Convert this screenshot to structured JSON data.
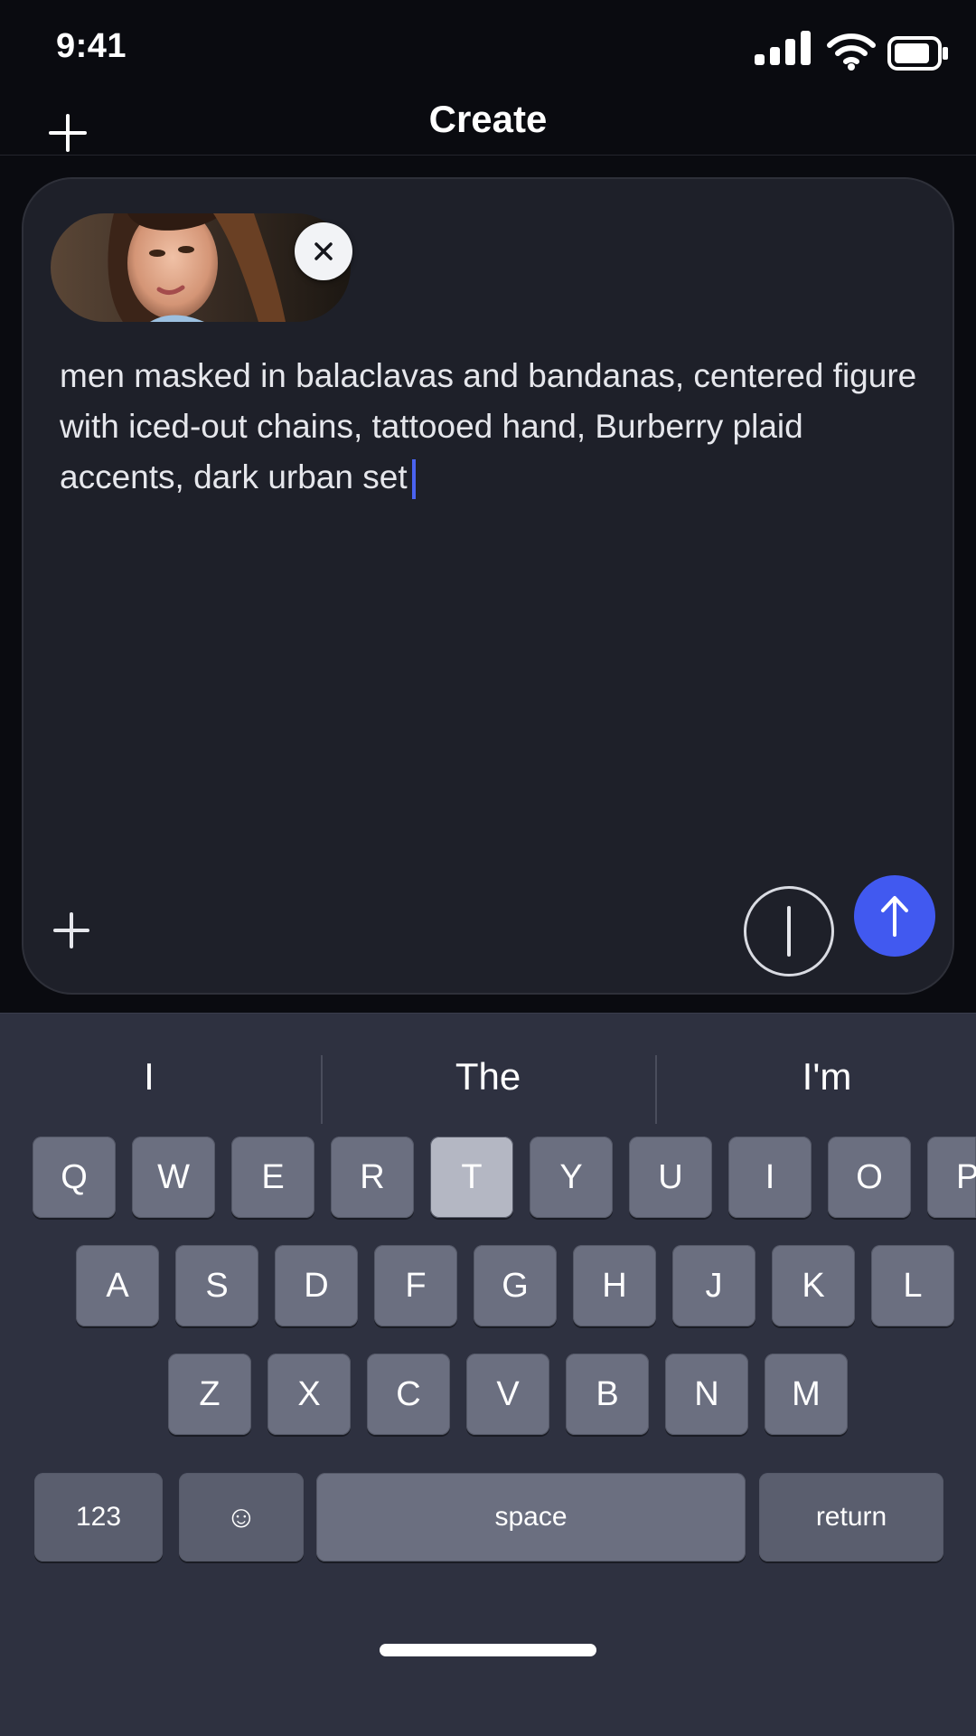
{
  "status_bar": {
    "time": "9:41",
    "icons": [
      "signal-icon",
      "wifi-icon",
      "battery-icon"
    ]
  },
  "header": {
    "title": "Create",
    "left_icon": "plus-icon"
  },
  "composer": {
    "attachment": {
      "type": "image",
      "remove_icon": "close-icon"
    },
    "prompt_text": "men masked in balaclavas and bandanas, centered figure with iced-out chains, tattooed hand, Burberry plaid accents, dark urban set",
    "add_icon": "plus-icon",
    "voice_icon": "mic-icon",
    "send_icon": "arrow-up-icon",
    "accent_color": "#4159f0"
  },
  "keyboard": {
    "suggestions": [
      "I",
      "The",
      "I'm"
    ],
    "rows": [
      [
        "Q",
        "W",
        "E",
        "R",
        "T",
        "Y",
        "U",
        "I",
        "O",
        "P"
      ],
      [
        "A",
        "S",
        "D",
        "F",
        "G",
        "H",
        "J",
        "K",
        "L"
      ],
      [
        "Z",
        "X",
        "C",
        "V",
        "B",
        "N",
        "M"
      ]
    ],
    "highlighted_key": "T",
    "bottom_row": {
      "numbers": "123",
      "emoji": "☺",
      "space": "space",
      "return": "return"
    }
  }
}
